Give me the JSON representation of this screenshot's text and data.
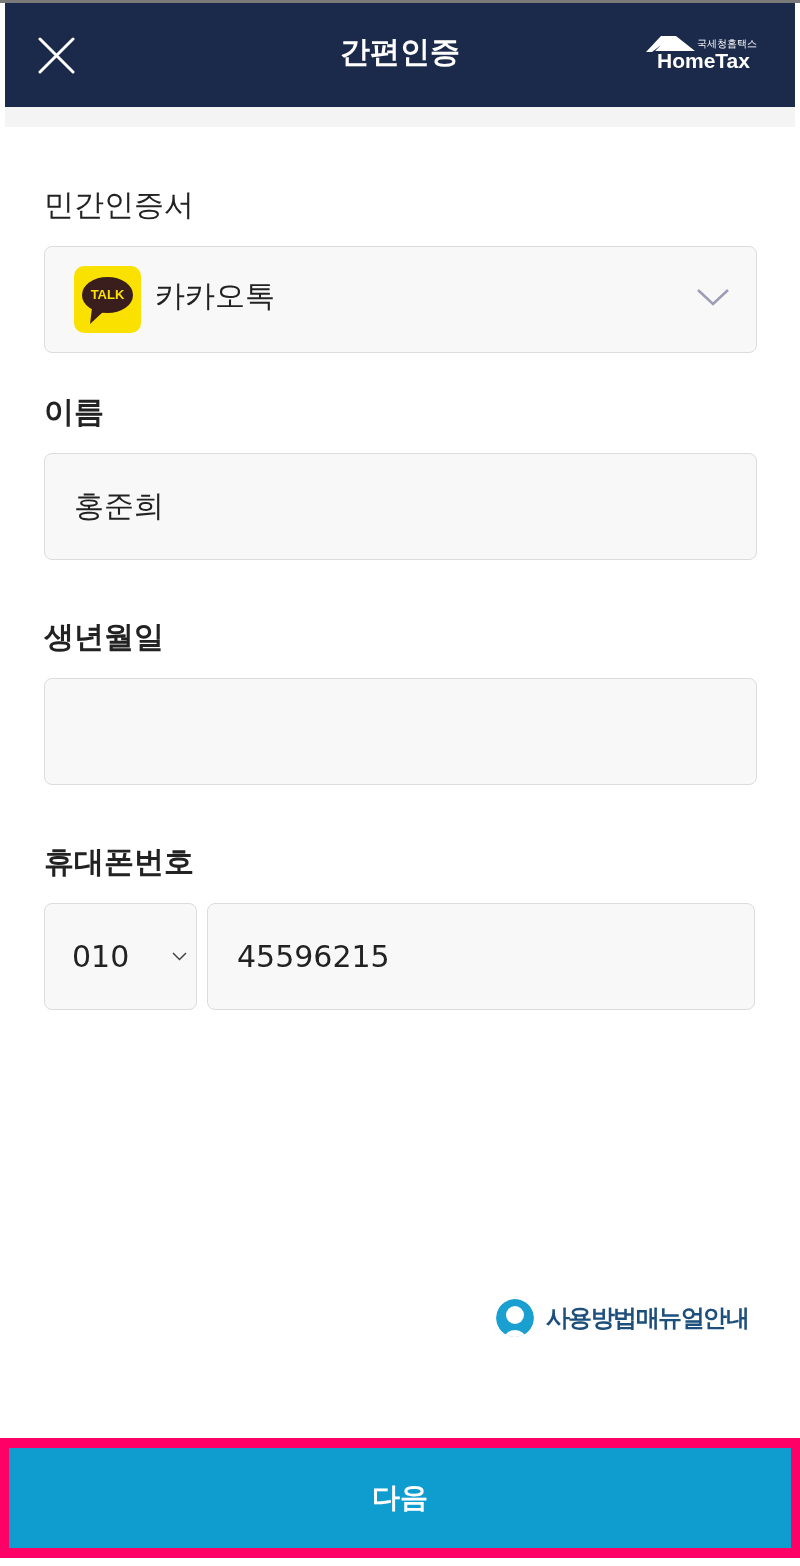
{
  "header": {
    "title": "간편인증",
    "logo": {
      "subtitle": "국세청홈택스",
      "wordmark": "HomeTax"
    }
  },
  "form": {
    "fields": [
      {
        "kind": "select",
        "label": "민간인증서",
        "value": "카카오톡",
        "icon_text": "TALK"
      },
      {
        "kind": "text",
        "label": "이름",
        "value": "홍준희"
      },
      {
        "kind": "text",
        "label": "생년월일"
      },
      {
        "kind": "phone",
        "label": "휴대폰번호",
        "prefix": "010",
        "value": "45596215"
      }
    ]
  },
  "manual_link": {
    "label": "사용방법매뉴얼안내"
  },
  "next_button": {
    "label": "다음",
    "highlighted": true
  }
}
